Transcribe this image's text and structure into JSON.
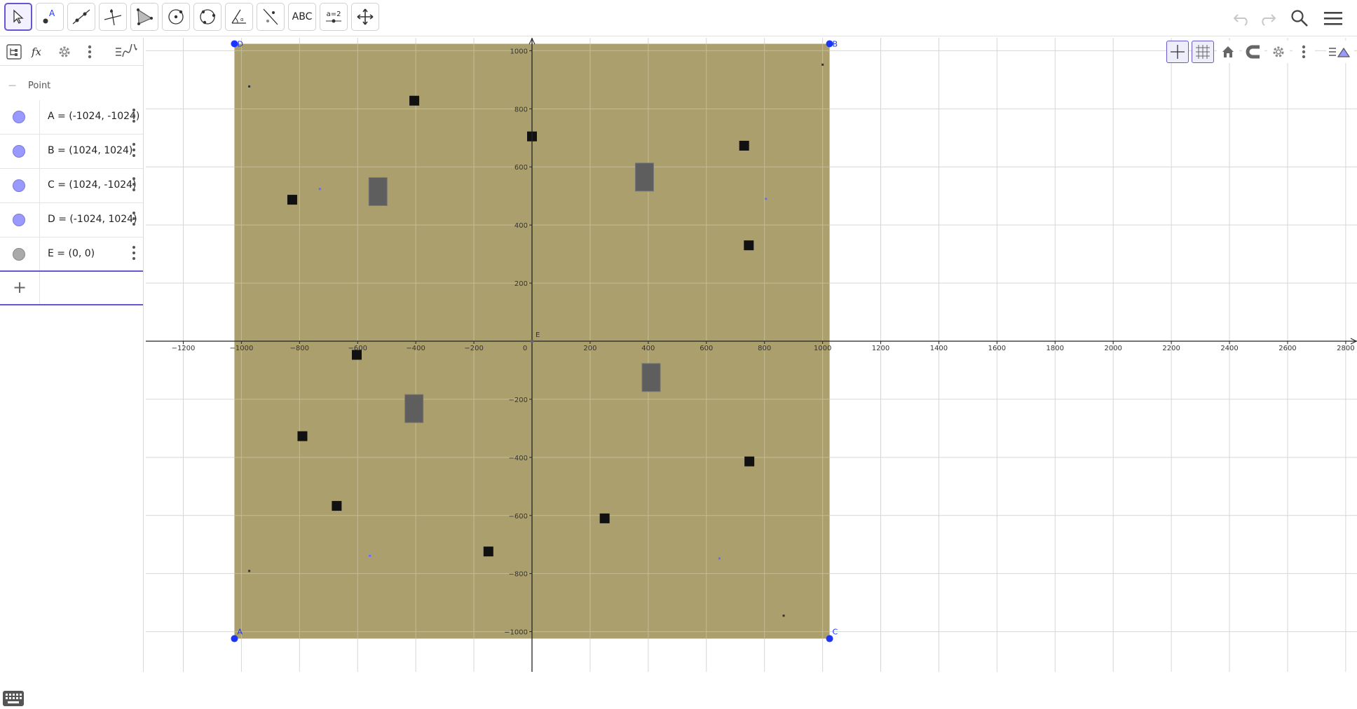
{
  "toolbar": {
    "tools": [
      {
        "name": "move-tool",
        "icon": "pointer-arrow-icon"
      },
      {
        "name": "point-tool",
        "icon": "point-icon",
        "letter": "A"
      },
      {
        "name": "line-tool",
        "icon": "line-icon"
      },
      {
        "name": "perpendicular-tool",
        "icon": "perpendicular-line-icon"
      },
      {
        "name": "polygon-tool",
        "icon": "polygon-icon"
      },
      {
        "name": "circle-tool",
        "icon": "circle-center-icon"
      },
      {
        "name": "circle-through-points-tool",
        "icon": "circle-three-points-icon"
      },
      {
        "name": "angle-tool",
        "icon": "angle-icon"
      },
      {
        "name": "reflect-tool",
        "icon": "reflect-line-icon"
      },
      {
        "name": "text-tool",
        "icon": "text-icon",
        "label": "ABC"
      },
      {
        "name": "slider-tool",
        "icon": "slider-icon",
        "label": "a=2"
      },
      {
        "name": "move-graphics-tool",
        "icon": "move-graphics-icon"
      }
    ],
    "active_tool": "move-tool",
    "right": {
      "undo": "undo-icon",
      "redo": "redo-icon",
      "search": "search-icon",
      "menu": "menu-icon"
    }
  },
  "algebra": {
    "header_icons": [
      "algebra-view-icon",
      "fx-icon",
      "gear-icon",
      "more-vertical-icon",
      "graph-style-icon"
    ],
    "group_label": "Point",
    "group_collapse": "—",
    "items": [
      {
        "formula": "A = (-1024, -1024)",
        "color": "#9999ff"
      },
      {
        "formula": "B = (1024, 1024)",
        "color": "#9999ff"
      },
      {
        "formula": "C = (1024, -1024)",
        "color": "#9999ff"
      },
      {
        "formula": "D = (-1024, 1024)",
        "color": "#9999ff"
      },
      {
        "formula": "E = (0, 0)",
        "color": "#aaaaaa"
      }
    ],
    "input_plus": "+",
    "keyboard_icon": "keyboard-icon"
  },
  "style_bar": {
    "icons": [
      "axes-icon",
      "grid-icon",
      "home-icon",
      "magnet-icon",
      "gear-icon",
      "more-vertical-icon",
      "graph-style-icon"
    ],
    "active": [
      "axes-icon",
      "grid-icon"
    ]
  },
  "graphics": {
    "x_ticks": [
      -1200,
      -1000,
      -800,
      -600,
      -400,
      -200,
      0,
      200,
      400,
      600,
      800,
      1000,
      1200,
      1400,
      1600,
      1800,
      2000,
      2200,
      2400,
      2600,
      2800
    ],
    "y_ticks": [
      1000,
      800,
      600,
      400,
      200,
      -200,
      -400,
      -600,
      -800,
      -1000
    ],
    "x_tick_labels": [
      "−1200",
      "−1000",
      "−800",
      "−600",
      "−400",
      "−200",
      "0",
      "200",
      "400",
      "600",
      "800",
      "1000",
      "1200",
      "1400",
      "1600",
      "1800",
      "2000",
      "2200",
      "2400",
      "2600",
      "2800"
    ],
    "y_tick_labels": [
      "1000",
      "800",
      "600",
      "400",
      "200",
      "−200",
      "−400",
      "−600",
      "−800",
      "−1000"
    ],
    "fill_color": "#ab9f6d",
    "points": [
      {
        "label": "A",
        "x": -1024,
        "y": -1024
      },
      {
        "label": "B",
        "x": 1024,
        "y": 1024
      },
      {
        "label": "C",
        "x": 1024,
        "y": -1024
      },
      {
        "label": "D",
        "x": -1024,
        "y": 1024
      },
      {
        "label": "E",
        "x": 0,
        "y": 0
      }
    ],
    "black_squares": [
      {
        "x": -405,
        "y": 828
      },
      {
        "x": 0,
        "y": 705
      },
      {
        "x": -825,
        "y": 487
      },
      {
        "x": 730,
        "y": 673
      },
      {
        "x": 746,
        "y": 330
      },
      {
        "x": -603,
        "y": -47
      },
      {
        "x": -790,
        "y": -327
      },
      {
        "x": -672,
        "y": -567
      },
      {
        "x": 250,
        "y": -610
      },
      {
        "x": -150,
        "y": -724
      },
      {
        "x": 748,
        "y": -414
      }
    ],
    "gray_rects": [
      {
        "x": -530,
        "y": 515
      },
      {
        "x": 387,
        "y": 565
      },
      {
        "x": 410,
        "y": -125
      },
      {
        "x": -406,
        "y": -232
      }
    ],
    "small_dots": [
      {
        "x": -973,
        "y": 877,
        "color": "#333333"
      },
      {
        "x": 1000,
        "y": 952,
        "color": "#333333"
      },
      {
        "x": -730,
        "y": 524,
        "color": "#6a6aff"
      },
      {
        "x": 805,
        "y": 490,
        "color": "#6a6aff"
      },
      {
        "x": -558,
        "y": -739,
        "color": "#6a6aff"
      },
      {
        "x": 645,
        "y": -748,
        "color": "#6a6aff"
      },
      {
        "x": -973,
        "y": -791,
        "color": "#333333"
      },
      {
        "x": 866,
        "y": -945,
        "color": "#333333"
      }
    ]
  }
}
